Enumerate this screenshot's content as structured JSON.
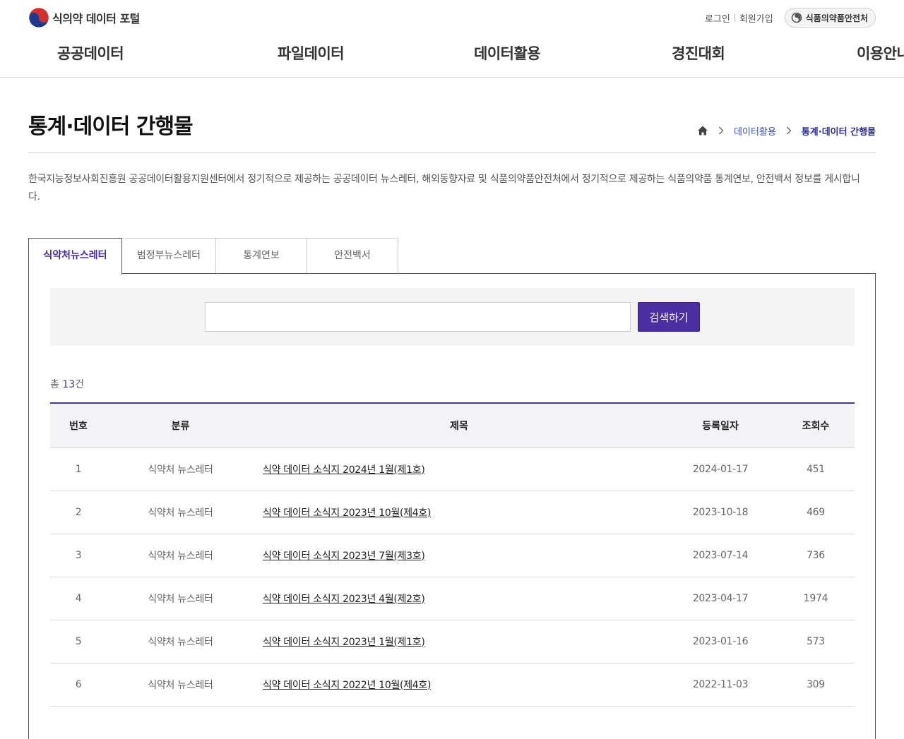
{
  "header": {
    "logo_text": "식의약 데이터 포털",
    "util": {
      "login": "로그인",
      "signup": "회원가입",
      "org": "식품의약품안전처"
    },
    "nav": [
      "공공데이터",
      "파일데이터",
      "데이터활용",
      "경진대회",
      "이용안내"
    ]
  },
  "page": {
    "title": "통계·데이터 간행물",
    "breadcrumb": [
      "데이터활용",
      "통계·데이터 간행물"
    ],
    "intro": "한국지능정보사회진흥원 공공데이터활용지원센터에서 정기적으로 제공하는 공공데이터 뉴스레터, 해외동향자료 및 식품의약품안전처에서 정기적으로 제공하는 식품의약품 통계연보, 안전백서 정보를 게시합니다."
  },
  "tabs": [
    {
      "label": "식약처뉴스레터",
      "active": true
    },
    {
      "label": "범정부뉴스레터",
      "active": false
    },
    {
      "label": "통계연보",
      "active": false
    },
    {
      "label": "안전백서",
      "active": false
    }
  ],
  "search": {
    "value": "",
    "placeholder": "",
    "button": "검색하기"
  },
  "total": {
    "prefix": "총 ",
    "count": "13",
    "suffix": "건"
  },
  "table": {
    "headers": [
      "번호",
      "분류",
      "제목",
      "등록일자",
      "조회수"
    ],
    "rows": [
      {
        "no": "1",
        "category": "식약처 뉴스레터",
        "title": "식약 데이터 소식지 2024년 1월(제1호)",
        "date": "2024-01-17",
        "views": "451"
      },
      {
        "no": "2",
        "category": "식약처 뉴스레터",
        "title": "식약 데이터 소식지 2023년 10월(제4호)",
        "date": "2023-10-18",
        "views": "469"
      },
      {
        "no": "3",
        "category": "식약처 뉴스레터",
        "title": "식약 데이터 소식지 2023년 7월(제3호)",
        "date": "2023-07-14",
        "views": "736"
      },
      {
        "no": "4",
        "category": "식약처 뉴스레터",
        "title": "식약 데이터 소식지 2023년 4월(제2호)",
        "date": "2023-04-17",
        "views": "1974"
      },
      {
        "no": "5",
        "category": "식약처 뉴스레터",
        "title": "식약 데이터 소식지 2023년 1월(제1호)",
        "date": "2023-01-16",
        "views": "573"
      },
      {
        "no": "6",
        "category": "식약처 뉴스레터",
        "title": "식약 데이터 소식지 2022년 10월(제4호)",
        "date": "2022-11-03",
        "views": "309"
      }
    ]
  },
  "colors": {
    "accent": "#4b2fa0",
    "header_rule": "#4b3a8f"
  },
  "icons": {
    "home": "home-icon",
    "breadcrumb_separator": "chevron-right-icon",
    "logo": "taegeuk-logo-icon"
  }
}
